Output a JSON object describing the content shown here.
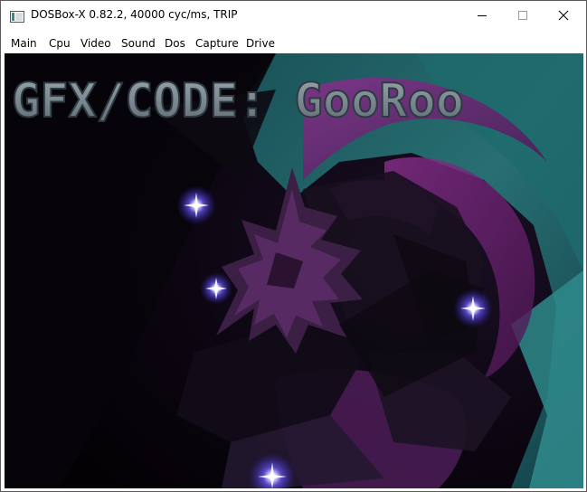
{
  "window": {
    "title": "DOSBox-X 0.82.2, 40000 cyc/ms, TRIP",
    "controls": [
      "minimize",
      "maximize",
      "close"
    ]
  },
  "menu": {
    "items": [
      {
        "label": "Main"
      },
      {
        "label": "Cpu"
      },
      {
        "label": "Video"
      },
      {
        "label": "Sound"
      },
      {
        "label": "Dos"
      },
      {
        "label": "Capture"
      },
      {
        "label": "Drive"
      }
    ]
  },
  "demo": {
    "banner_text": "GFX/CODE: GooRoo",
    "colors": {
      "background": "#050208",
      "tunnel_teal": "#1f5f63",
      "tunnel_magenta": "#7a2a7e",
      "banner": "#7f8c95",
      "star_glow": "#6b5cff"
    }
  }
}
